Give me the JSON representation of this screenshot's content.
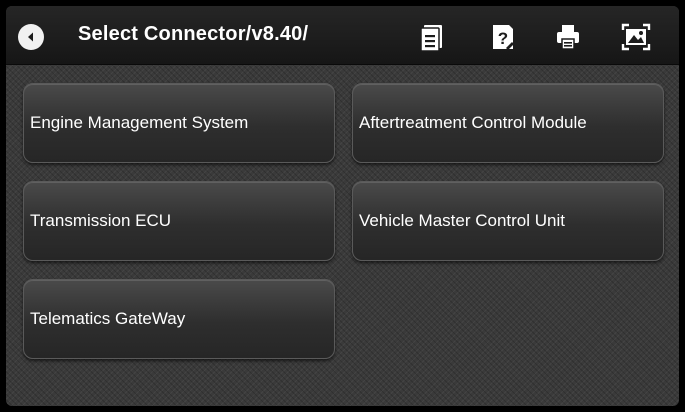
{
  "header": {
    "title": "Select Connector/v8.40/",
    "icons": [
      "back-icon",
      "report-icon",
      "help-icon",
      "print-icon",
      "screenshot-icon"
    ]
  },
  "connectors": [
    {
      "label": "Engine Management System"
    },
    {
      "label": "Aftertreatment Control Module"
    },
    {
      "label": "Transmission ECU"
    },
    {
      "label": "Vehicle Master Control Unit"
    },
    {
      "label": "Telematics GateWay"
    }
  ],
  "colors": {
    "header_bg": "#1c1c1c",
    "button_bg": "#333333",
    "text": "#ffffff"
  }
}
